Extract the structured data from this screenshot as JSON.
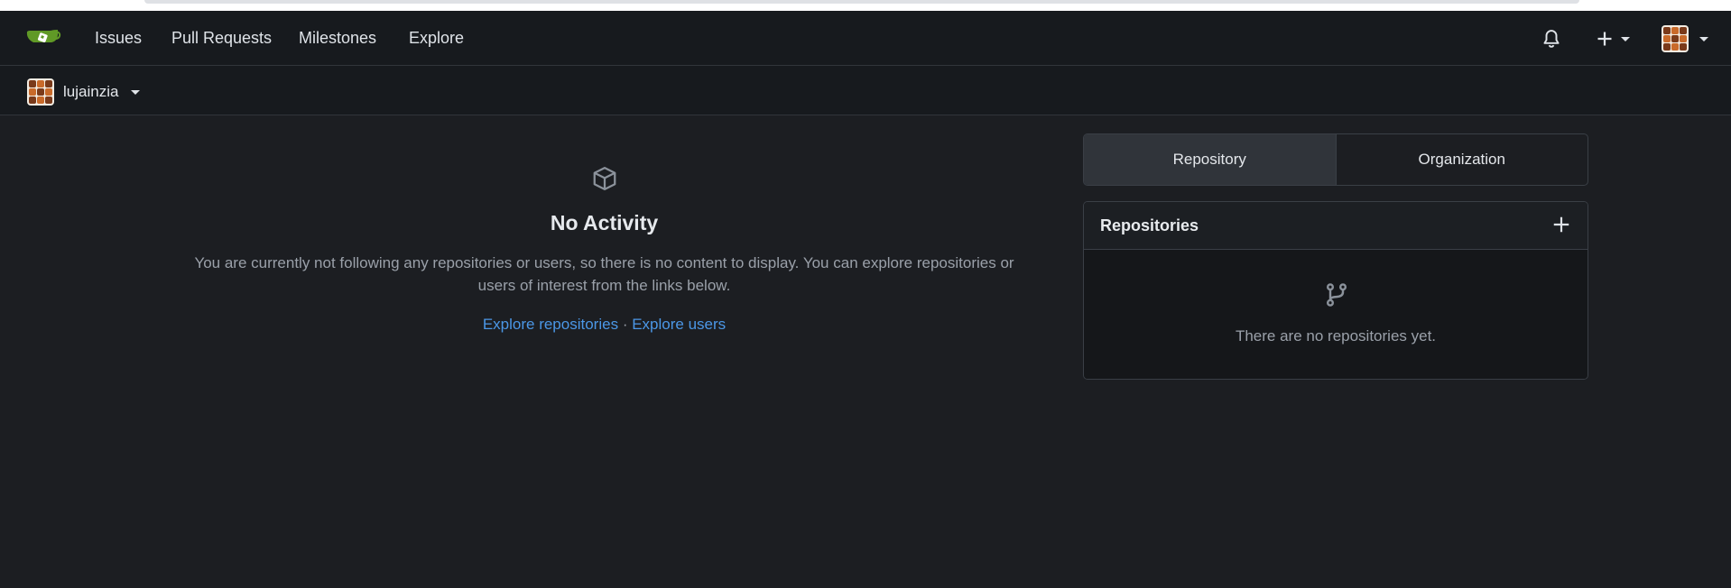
{
  "nav": {
    "links": [
      "Issues",
      "Pull Requests",
      "Milestones",
      "Explore"
    ]
  },
  "context": {
    "username": "lujainzia"
  },
  "feed": {
    "title": "No Activity",
    "description": "You are currently not following any repositories or users, so there is no content to display. You can explore repositories or users of interest from the links below.",
    "explore_repos": "Explore repositories",
    "separator": "·",
    "explore_users": "Explore users"
  },
  "tabs": [
    "Repository",
    "Organization"
  ],
  "repositories": {
    "title": "Repositories",
    "empty_message": "There are no repositories yet."
  },
  "colors": {
    "accent_link": "#4b97e6",
    "logo_green": "#609926",
    "background": "#1c1e22",
    "nav_background": "#171a1e"
  },
  "icons": {
    "logo": "gitea-logo",
    "notifications": "bell-icon",
    "create": "plus-icon",
    "feed_empty": "package-icon",
    "repos_empty": "repo-forked-icon"
  }
}
